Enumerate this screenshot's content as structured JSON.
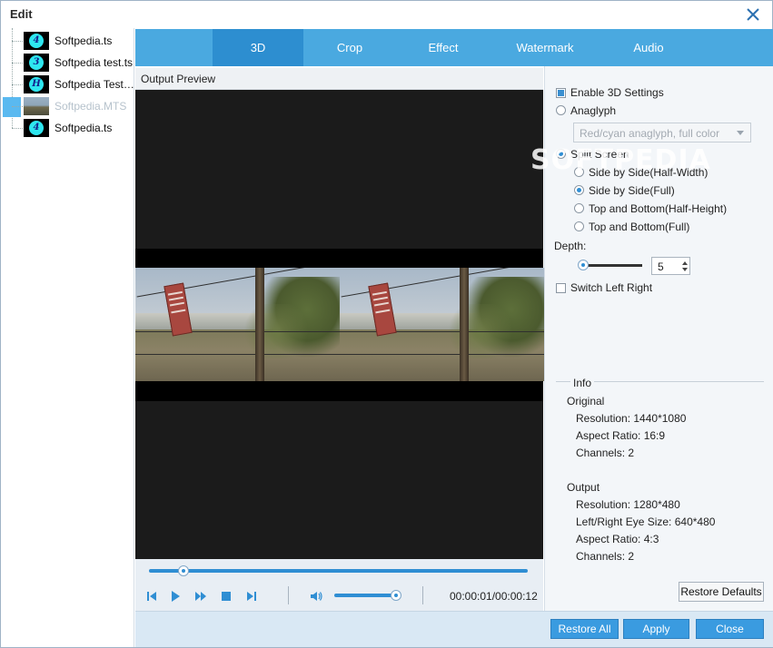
{
  "window": {
    "title": "Edit"
  },
  "files": [
    {
      "name": "Softpedia.ts",
      "thumb_glyph": "4",
      "thumb_kind": "disc"
    },
    {
      "name": "Softpedia test.ts",
      "thumb_glyph": "3",
      "thumb_kind": "disc"
    },
    {
      "name": "Softpedia Test…",
      "thumb_glyph": "H",
      "thumb_kind": "disc"
    },
    {
      "name": "Softpedia.MTS",
      "thumb_glyph": "",
      "thumb_kind": "landscape",
      "selected": true
    },
    {
      "name": "Softpedia.ts",
      "thumb_glyph": "4",
      "thumb_kind": "disc"
    }
  ],
  "tabs": [
    {
      "label": "3D",
      "active": true
    },
    {
      "label": "Crop",
      "active": false
    },
    {
      "label": "Effect",
      "active": false
    },
    {
      "label": "Watermark",
      "active": false
    },
    {
      "label": "Audio",
      "active": false
    }
  ],
  "preview": {
    "header": "Output Preview",
    "time": "00:00:01/00:00:12",
    "seek_fraction": 0.09,
    "volume_fraction": 1.0
  },
  "settings": {
    "enable_3d": {
      "label": "Enable 3D Settings",
      "checked": true
    },
    "anaglyph": {
      "label": "Anaglyph",
      "selected": false
    },
    "anaglyph_dropdown": {
      "value": "Red/cyan anaglyph, full color"
    },
    "split_screen": {
      "label": "Split Screen",
      "selected": true
    },
    "split_options": [
      {
        "label": "Side by Side(Half-Width)",
        "selected": false
      },
      {
        "label": "Side by Side(Full)",
        "selected": true
      },
      {
        "label": "Top and Bottom(Half-Height)",
        "selected": false
      },
      {
        "label": "Top and Bottom(Full)",
        "selected": false
      }
    ],
    "depth": {
      "label": "Depth:",
      "value": "5",
      "slider_fraction": 0.0
    },
    "switch_left_right": {
      "label": "Switch Left Right",
      "checked": false
    }
  },
  "info": {
    "title": "Info",
    "original": {
      "heading": "Original",
      "resolution": "Resolution: 1440*1080",
      "aspect": "Aspect Ratio: 16:9",
      "channels": "Channels: 2"
    },
    "output": {
      "heading": "Output",
      "resolution": "Resolution: 1280*480",
      "eye_size": "Left/Right Eye Size: 640*480",
      "aspect": "Aspect Ratio: 4:3",
      "channels": "Channels: 2"
    }
  },
  "buttons": {
    "restore_defaults": "Restore Defaults",
    "restore_all": "Restore All",
    "apply": "Apply",
    "close": "Close"
  },
  "watermark_text": "SOFTPEDIA"
}
